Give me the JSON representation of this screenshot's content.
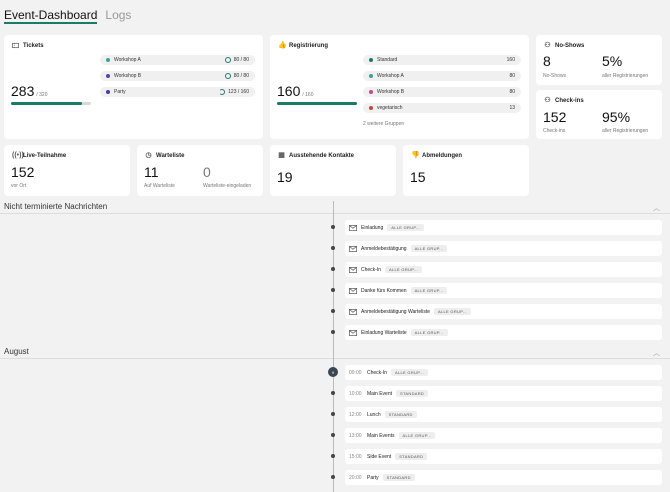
{
  "tabs": [
    {
      "label": "Event-Dashboard"
    },
    {
      "label": "Logs"
    }
  ],
  "tickets": {
    "title": "Tickets",
    "value": "283",
    "max": "/ 320",
    "progress": 0.884,
    "items": [
      {
        "label": "Workshop A",
        "value": "80 / 80",
        "color": "#3aa39a"
      },
      {
        "label": "Workshop B",
        "value": "80 / 80",
        "color": "#4a4aa8"
      },
      {
        "label": "Party",
        "value": "123 / 160",
        "color": "#4a3aa8"
      }
    ]
  },
  "registration": {
    "title": "Registrierung",
    "value": "160",
    "max": "/ 160",
    "progress": 1.0,
    "items": [
      {
        "label": "Standard",
        "value": "160",
        "color": "#1c7a6a"
      },
      {
        "label": "Workshop A",
        "value": "80",
        "color": "#3aa39a"
      },
      {
        "label": "Workshop B",
        "value": "80",
        "color": "#c04a8a"
      },
      {
        "label": "vegetarisch",
        "value": "13",
        "color": "#c04a3a"
      }
    ],
    "more": "2 weitere Gruppen"
  },
  "noshows": {
    "title": "No-Shows",
    "v1": "8",
    "l1": "No-Shows",
    "v2": "5%",
    "l2": "aller Registrierungen"
  },
  "checkins": {
    "title": "Check-ins",
    "v1": "152",
    "l1": "Check-ins",
    "v2": "95%",
    "l2": "aller Registrierungen"
  },
  "live": {
    "title": "Live-Teilnahme",
    "value": "152",
    "label": "vor Ort"
  },
  "waitlist": {
    "title": "Warteliste",
    "v1": "11",
    "l1": "Auf Warteliste",
    "v2": "0",
    "l2": "Warteliste-eingeladen"
  },
  "contacts": {
    "title": "Ausstehende Kontakte",
    "value": "19"
  },
  "cancellations": {
    "title": "Abmeldungen",
    "value": "15"
  },
  "section1": {
    "title": "Nicht terminierte Nachrichten",
    "rows": [
      {
        "name": "Einladung",
        "tag": "ALLE GRUP..."
      },
      {
        "name": "Anmeldebestätigung",
        "tag": "ALLE GRUP..."
      },
      {
        "name": "Check-In",
        "tag": "ALLE GRUP..."
      },
      {
        "name": "Danke fürs Kommen",
        "tag": "ALLE GRUP..."
      },
      {
        "name": "Anmeldebestätigung Warteliste",
        "tag": "ALLE GRUP..."
      },
      {
        "name": "Einladung Warteliste",
        "tag": "ALLE GRUP..."
      }
    ]
  },
  "section2": {
    "title": "August",
    "day": "9",
    "rows": [
      {
        "time": "09:00",
        "name": "Check-In",
        "tag": "ALLE GRUP..."
      },
      {
        "time": "10:00",
        "name": "Main Event",
        "tag": "STANDARD"
      },
      {
        "time": "12:00",
        "name": "Lunch",
        "tag": "STANDARD"
      },
      {
        "time": "13:00",
        "name": "Main Events",
        "tag": "ALLE GRUP..."
      },
      {
        "time": "15:00",
        "name": "Side Event",
        "tag": "STANDARD"
      },
      {
        "time": "20:00",
        "name": "Party",
        "tag": "STANDARD"
      }
    ]
  },
  "colors": {
    "accent": "#1c7a6a"
  },
  "icons": {
    "tickets": "ticket-icon",
    "registration": "thumbs-up-icon",
    "noshows": "user-x-icon",
    "checkins": "user-check-icon",
    "live": "broadcast-icon",
    "waitlist": "clock-icon",
    "contacts": "calendar-icon",
    "cancellations": "thumbs-down-icon",
    "message": "envelope-icon",
    "collapse": "chevron-up-icon"
  }
}
